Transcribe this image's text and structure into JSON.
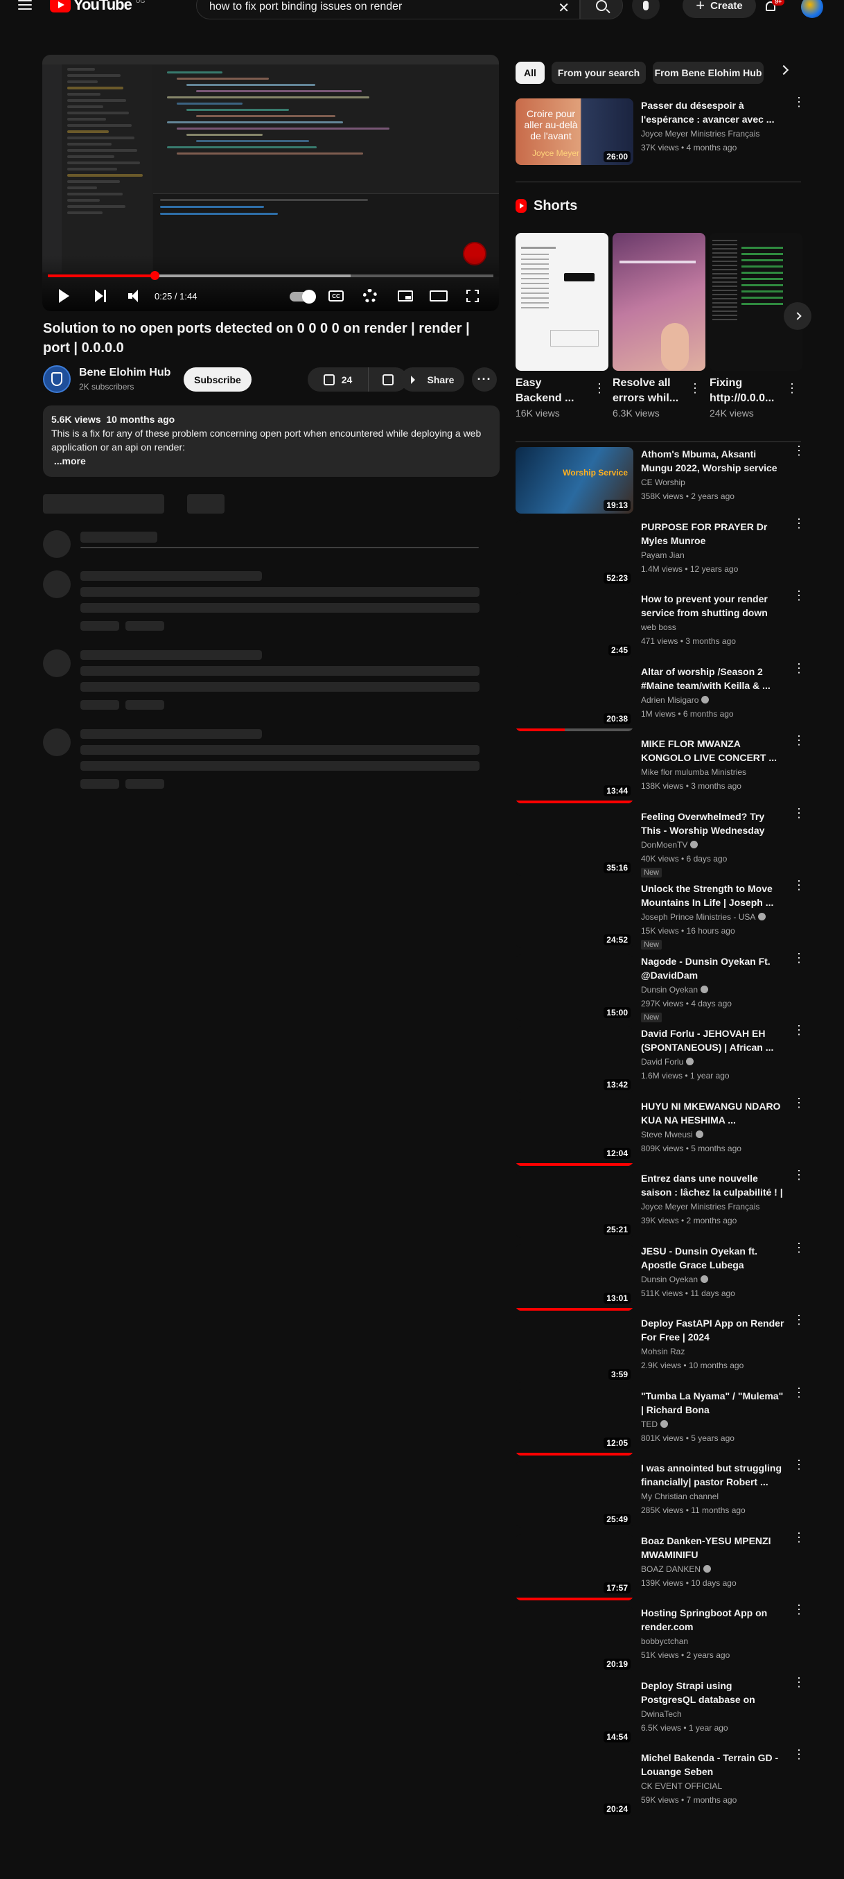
{
  "header": {
    "logo_text": "YouTube",
    "country_code": "UG",
    "search_query": "how to fix port binding issues on render",
    "create_label": "Create",
    "notification_count": "9+"
  },
  "player": {
    "current_time": "0:25",
    "duration": "1:44",
    "time_display": "0:25 / 1:44",
    "progress_fraction": 0.24,
    "buffered_fraction": 0.68
  },
  "video": {
    "title": "Solution to no open ports detected on 0 0 0 0 on render | render | port | 0.0.0.0",
    "channel_name": "Bene Elohim Hub",
    "subscribers": "2K subscribers",
    "subscribe_label": "Subscribe",
    "like_count": "24",
    "share_label": "Share",
    "views": "5.6K views",
    "age": "10 months ago",
    "description": "This is a fix for any of these problem concerning open port when encountered while deploying a web application or an api on render:",
    "more_label": "...more"
  },
  "filter_chips": [
    "All",
    "From your search",
    "From Bene Elohim Hub"
  ],
  "shorts": {
    "heading": "Shorts",
    "items": [
      {
        "title": "Easy Backend ...",
        "views": "16K views"
      },
      {
        "title": "Resolve all errors whil...",
        "views": "6.3K views"
      },
      {
        "title": "Fixing http://0.0.0...",
        "views": "24K views"
      }
    ]
  },
  "top_recommendation": {
    "title": "Passer du désespoir à l'espérance : avancer avec ...",
    "channel": "Joyce Meyer Ministries Français",
    "meta": "37K views • 4 months ago",
    "duration": "26:00",
    "thumb_text": "Croire pour aller au-delà de l'avant",
    "thumb_caption": "Joyce Meyer"
  },
  "recommendations": [
    {
      "title": "Athom's Mbuma, Aksanti Mungu 2022, Worship service",
      "channel": "CE Worship",
      "verified": false,
      "meta": "358K views • 2 years ago",
      "duration": "19:13",
      "new": false,
      "watched": 0,
      "thumb_text": "Worship Service"
    },
    {
      "title": "PURPOSE FOR PRAYER  Dr Myles Munroe",
      "channel": "Payam Jian",
      "verified": false,
      "meta": "1.4M views • 12 years ago",
      "duration": "52:23",
      "new": false,
      "watched": 0
    },
    {
      "title": "How to prevent your render service from shutting down",
      "channel": "web boss",
      "verified": false,
      "meta": "471 views • 3 months ago",
      "duration": "2:45",
      "new": false,
      "watched": 0
    },
    {
      "title": "Altar of worship /Season 2 #Maine team/with Keilla & ...",
      "channel": "Adrien Misigaro",
      "verified": true,
      "meta": "1M views • 6 months ago",
      "duration": "20:38",
      "new": false,
      "watched": 0.42
    },
    {
      "title": "MIKE FLOR MWANZA KONGOLO LIVE CONCERT ...",
      "channel": "Mike flor mulumba Ministries",
      "verified": false,
      "meta": "138K views • 3 months ago",
      "duration": "13:44",
      "new": false,
      "watched": 1
    },
    {
      "title": "Feeling Overwhelmed? Try This - Worship Wednesday with Do...",
      "channel": "DonMoenTV",
      "verified": true,
      "meta": "40K views • 6 days ago",
      "duration": "35:16",
      "new": true,
      "watched": 0
    },
    {
      "title": "Unlock the Strength to Move Mountains In Life | Joseph ...",
      "channel": "Joseph Prince Ministries - USA",
      "verified": true,
      "meta": "15K views • 16 hours ago",
      "duration": "24:52",
      "new": true,
      "watched": 0
    },
    {
      "title": "Nagode - Dunsin Oyekan Ft. @DavidDam",
      "channel": "Dunsin Oyekan",
      "verified": true,
      "meta": "297K views • 4 days ago",
      "duration": "15:00",
      "new": true,
      "watched": 0
    },
    {
      "title": "David Forlu - JEHOVAH EH (SPONTANEOUS) | African ...",
      "channel": "David Forlu",
      "verified": true,
      "meta": "1.6M views • 1 year ago",
      "duration": "13:42",
      "new": false,
      "watched": 0
    },
    {
      "title": "HUYU NI MKEWANGU NDARO KUA NA HESHIMA ...",
      "channel": "Steve Mweusi",
      "verified": true,
      "meta": "809K views • 5 months ago",
      "duration": "12:04",
      "new": false,
      "watched": 1
    },
    {
      "title": "Entrez dans une nouvelle saison : lâchez la culpabilité ! | Joyce ...",
      "channel": "Joyce Meyer Ministries Français",
      "verified": false,
      "meta": "39K views • 2 months ago",
      "duration": "25:21",
      "new": false,
      "watched": 0
    },
    {
      "title": "JESU - Dunsin Oyekan ft. Apostle Grace Lubega",
      "channel": "Dunsin Oyekan",
      "verified": true,
      "meta": "511K views • 11 days ago",
      "duration": "13:01",
      "new": false,
      "watched": 1
    },
    {
      "title": "Deploy FastAPI App on Render For Free | 2024",
      "channel": "Mohsin Raz",
      "verified": false,
      "meta": "2.9K views • 10 months ago",
      "duration": "3:59",
      "new": false,
      "watched": 0
    },
    {
      "title": "\"Tumba La Nyama\" / \"Mulema\" | Richard Bona",
      "channel": "TED",
      "verified": true,
      "meta": "801K views • 5 years ago",
      "duration": "12:05",
      "new": false,
      "watched": 1
    },
    {
      "title": "I was annointed but struggling financially| pastor Robert ...",
      "channel": "My Christian channel",
      "verified": false,
      "meta": "285K views • 11 months ago",
      "duration": "25:49",
      "new": false,
      "watched": 0
    },
    {
      "title": "Boaz Danken-YESU MPENZI MWAMINIFU",
      "channel": "BOAZ DANKEN",
      "verified": true,
      "meta": "139K views • 10 days ago",
      "duration": "17:57",
      "new": false,
      "watched": 1
    },
    {
      "title": "Hosting Springboot App on render.com",
      "channel": "bobbyctchan",
      "verified": false,
      "meta": "51K views • 2 years ago",
      "duration": "20:19",
      "new": false,
      "watched": 0
    },
    {
      "title": "Deploy Strapi using PostgresQL database on render hosting",
      "channel": "DwinaTech",
      "verified": false,
      "meta": "6.5K views • 1 year ago",
      "duration": "14:54",
      "new": false,
      "watched": 0
    },
    {
      "title": "Michel Bakenda -  Terrain GD - Louange Seben",
      "channel": "CK EVENT OFFICIAL",
      "verified": false,
      "meta": "59K views • 7 months ago",
      "duration": "20:24",
      "new": false,
      "watched": 0
    }
  ],
  "new_badge_label": "New",
  "colors": {
    "accent": "#ff0000",
    "background": "#0f0f0f",
    "chip": "#272727"
  }
}
